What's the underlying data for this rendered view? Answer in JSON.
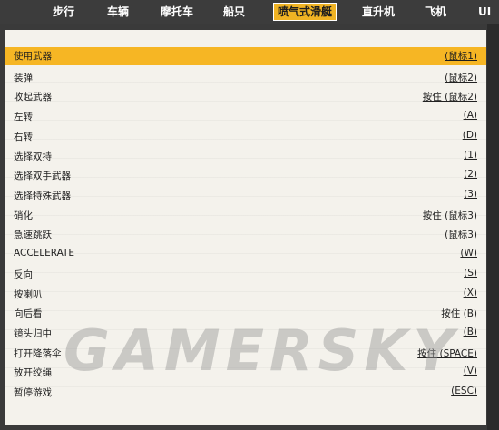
{
  "tabs": [
    {
      "label": "步行",
      "active": false
    },
    {
      "label": "车辆",
      "active": false
    },
    {
      "label": "摩托车",
      "active": false
    },
    {
      "label": "船只",
      "active": false
    },
    {
      "label": "喷气式滑艇",
      "active": true
    },
    {
      "label": "直升机",
      "active": false
    },
    {
      "label": "飞机",
      "active": false
    },
    {
      "label": "UI",
      "active": false
    }
  ],
  "bindings": [
    {
      "action": "使用武器",
      "key": "(鼠标1)",
      "selected": true
    },
    {
      "action": "装弹",
      "key": "(鼠标2)"
    },
    {
      "action": "收起武器",
      "key": "按住 (鼠标2)"
    },
    {
      "action": "左转",
      "key": "(A)"
    },
    {
      "action": "右转",
      "key": "(D)"
    },
    {
      "action": "选择双持",
      "key": "(1)"
    },
    {
      "action": "选择双手武器",
      "key": "(2)"
    },
    {
      "action": "选择特殊武器",
      "key": "(3)"
    },
    {
      "action": "硝化",
      "key": "按住 (鼠标3)"
    },
    {
      "action": "急速跳跃",
      "key": "(鼠标3)"
    },
    {
      "action": "ACCELERATE",
      "key": "(W)"
    },
    {
      "action": "反向",
      "key": "(S)"
    },
    {
      "action": "按喇叭",
      "key": "(X)"
    },
    {
      "action": "向后看",
      "key": "按住 (B)"
    },
    {
      "action": "镜头归中",
      "key": "(B)"
    },
    {
      "action": "打开降落伞",
      "key": "按住 (SPACE)"
    },
    {
      "action": "放开绞绳",
      "key": "(V)"
    },
    {
      "action": "暂停游戏",
      "key": "(ESC)"
    }
  ],
  "watermark": "GAMERSKY",
  "colors": {
    "accent": "#f6b624",
    "tabbar": "#3c3c3c",
    "paper": "#f4f2ec"
  }
}
